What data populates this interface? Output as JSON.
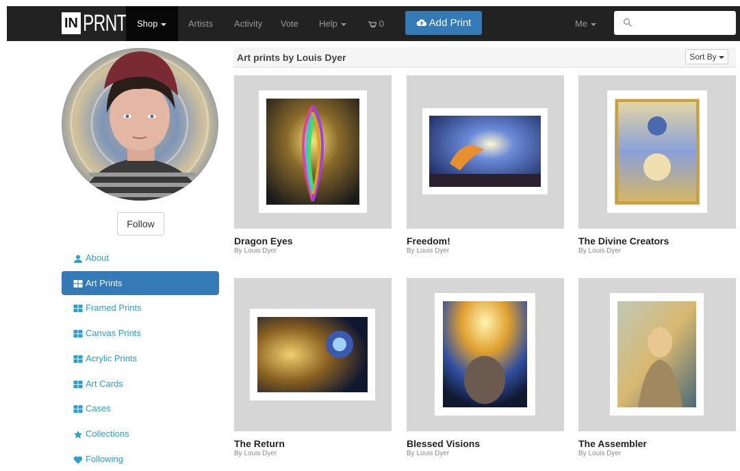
{
  "nav": {
    "logo_box": "IN",
    "logo_text": "PRNT",
    "shop": "Shop",
    "artists": "Artists",
    "activity": "Activity",
    "vote": "Vote",
    "help": "Help",
    "cart_count": "0",
    "add_print": "Add Print",
    "me": "Me",
    "search_placeholder": ""
  },
  "profile": {
    "follow": "Follow"
  },
  "sidebar": {
    "items": [
      {
        "label": "About",
        "icon": "user-icon"
      },
      {
        "label": "Art Prints",
        "icon": "grid-icon",
        "active": true
      },
      {
        "label": "Framed Prints",
        "icon": "grid-icon"
      },
      {
        "label": "Canvas Prints",
        "icon": "grid-icon"
      },
      {
        "label": "Acrylic Prints",
        "icon": "grid-icon"
      },
      {
        "label": "Art Cards",
        "icon": "grid-icon"
      },
      {
        "label": "Cases",
        "icon": "grid-icon"
      },
      {
        "label": "Collections",
        "icon": "star-icon"
      },
      {
        "label": "Following",
        "icon": "heart-icon"
      }
    ]
  },
  "main": {
    "heading": "Art prints by Louis Dyer",
    "sort_by": "Sort By",
    "prints": [
      {
        "title": "Dragon Eyes",
        "by": "By Louis Dyer"
      },
      {
        "title": "Freedom!",
        "by": "By Louis Dyer"
      },
      {
        "title": "The Divine Creators",
        "by": "By Louis Dyer"
      },
      {
        "title": "The Return",
        "by": "By Louis Dyer"
      },
      {
        "title": "Blessed Visions",
        "by": "By Louis Dyer"
      },
      {
        "title": "The Assembler",
        "by": "By Louis Dyer"
      }
    ]
  },
  "colors": {
    "nav_bg": "#222222",
    "accent": "#337ab7",
    "link": "#2a9fd6"
  }
}
